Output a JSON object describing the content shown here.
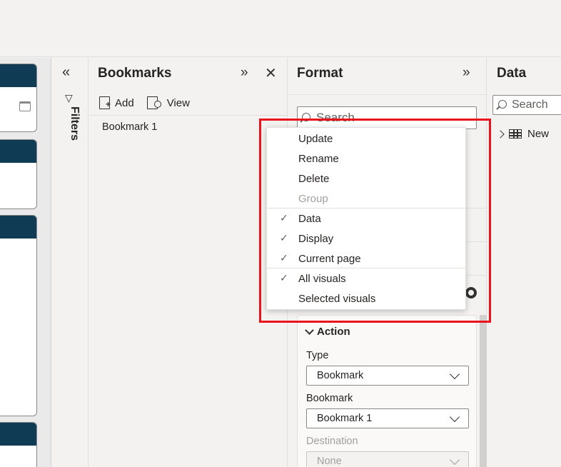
{
  "filters": {
    "label": "Filters",
    "collapse_icon": "double-chevron-left-icon"
  },
  "bookmarks": {
    "title": "Bookmarks",
    "add_label": "Add",
    "view_label": "View",
    "items": [
      {
        "label": "Bookmark 1"
      }
    ]
  },
  "format": {
    "title": "Format",
    "search_placeholder": "Search",
    "action": {
      "header": "Action",
      "type_label": "Type",
      "type_value": "Bookmark",
      "bookmark_label": "Bookmark",
      "bookmark_value": "Bookmark 1",
      "destination_label": "Destination",
      "destination_value": "None"
    }
  },
  "data": {
    "title": "Data",
    "search_placeholder": "Search",
    "tables": [
      {
        "label": "New"
      }
    ]
  },
  "context_menu": {
    "items": [
      {
        "label": "Update",
        "checked": false,
        "disabled": false
      },
      {
        "label": "Rename",
        "checked": false,
        "disabled": false
      },
      {
        "label": "Delete",
        "checked": false,
        "disabled": false
      },
      {
        "label": "Group",
        "checked": false,
        "disabled": true
      },
      {
        "label": "Data",
        "checked": true,
        "disabled": false
      },
      {
        "label": "Display",
        "checked": true,
        "disabled": false
      },
      {
        "label": "Current page",
        "checked": true,
        "disabled": false
      },
      {
        "label": "All visuals",
        "checked": true,
        "disabled": false
      },
      {
        "label": "Selected visuals",
        "checked": false,
        "disabled": false
      }
    ]
  },
  "colors": {
    "highlight": "#e8131b",
    "card_header": "#0f3b55",
    "pane_background": "#f3f2f1"
  }
}
